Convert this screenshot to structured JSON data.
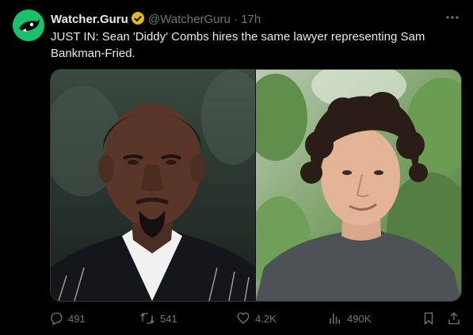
{
  "author": {
    "name": "Watcher.Guru",
    "handle": "@WatcherGuru",
    "separator": "·",
    "time": "17h"
  },
  "tweet": {
    "text": "JUST IN: Sean 'Diddy' Combs hires the same lawyer representing Sam Bankman-Fried."
  },
  "stats": {
    "replies": "491",
    "retweets": "541",
    "likes": "4.2K",
    "views": "490K"
  },
  "colors": {
    "background": "#000000",
    "text": "#e7e9ea",
    "secondary": "#71767b",
    "verified_badge": "#e2b719",
    "avatar_bg": "#19c26a"
  },
  "icons": {
    "avatar": "watcher-guru-logo",
    "verified": "verified-badge-icon",
    "more": "more-icon",
    "reply": "reply-icon",
    "retweet": "retweet-icon",
    "like": "heart-icon",
    "views": "views-icon",
    "bookmark": "bookmark-icon",
    "share": "share-icon"
  }
}
